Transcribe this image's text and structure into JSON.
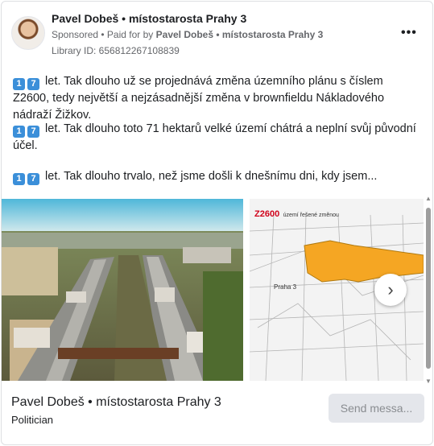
{
  "header": {
    "name": "Pavel Dobeš • místostarosta Prahy 3",
    "sponsored": "Sponsored",
    "paid_prefix": "• Paid for by",
    "paid_by": "Pavel Dobeš • místostarosta Prahy 3",
    "library_id": "Library ID: 656812267108839",
    "more_label": "•••"
  },
  "body": {
    "emoji": [
      "1",
      "7"
    ],
    "paragraphs": [
      "let. Tak dlouho už se projednává změna územního plánu s číslem Z2600, tedy největší a nejzásadnější změna v brownfieldu Nákladového nádraží Žižkov.",
      "let. Tak dlouho toto 71 hektarů velké území chátrá a neplní svůj původní účel.",
      "let. Tak dlouho trvalo, než jsme došli k dnešnímu dni, kdy jsem..."
    ]
  },
  "carousel": {
    "map_code": "Z2600",
    "map_caption": "území řešené změnou",
    "map_label": "Praha 3",
    "next_icon": "›"
  },
  "footer": {
    "name": "Pavel Dobeš • místostarosta Prahy 3",
    "role": "Politician",
    "send_label": "Send messa..."
  },
  "colors": {
    "highlight": "#f5a623",
    "map_title": "#d0021b",
    "emoji_bg": "#3b8fd9"
  }
}
